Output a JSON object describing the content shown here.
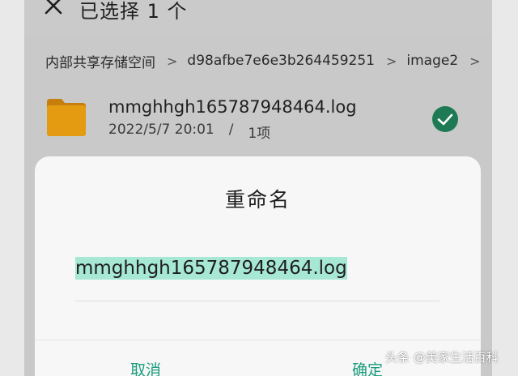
{
  "header": {
    "title": "已选择 1 个",
    "close_icon": "close-icon"
  },
  "breadcrumb": {
    "items": [
      "内部共享存储空间",
      "d98afbe7e6e3b264459251",
      "image2"
    ],
    "separator": ">"
  },
  "file": {
    "name": "mmghhgh165787948464.log",
    "date": "2022/5/7 20:01",
    "separator": "/",
    "count": "1项",
    "icon": "folder-icon",
    "selected": true
  },
  "dialog": {
    "title": "重命名",
    "input_value": "mmghhgh165787948464.log",
    "cancel_label": "取消",
    "confirm_label": "确定"
  },
  "watermark": "头条 @美家生活百科",
  "colors": {
    "accent": "#1a9d7e",
    "selection": "#a7e8d5",
    "check": "#1e7a55",
    "folder": "#e49b12"
  }
}
